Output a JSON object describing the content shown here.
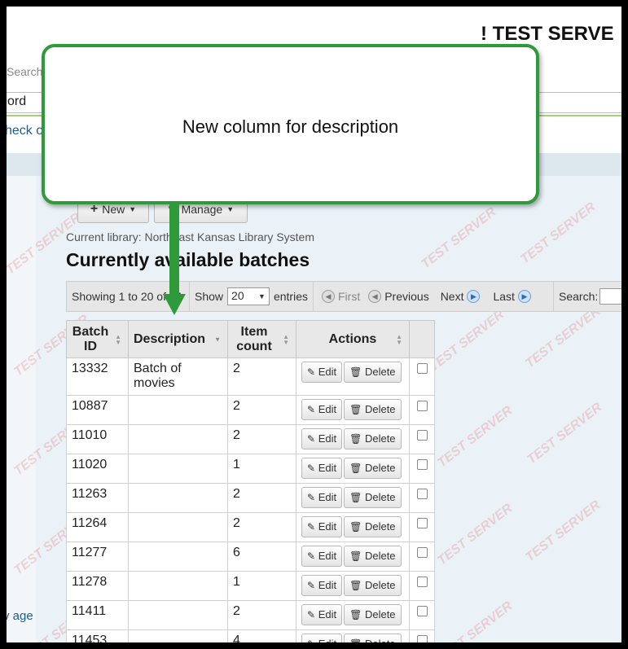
{
  "header": {
    "server_title": "! TEST SERVE",
    "search_label": "Search",
    "keyword_value": "ord",
    "check_link": "heck o",
    "page_link": "v age"
  },
  "watermark_text": "TEST SERVER",
  "toolbar": {
    "new_label": "New",
    "manage_label": "Manage"
  },
  "current_library": "Current library: Northeast Kansas Library System",
  "page_title": "Currently available batches",
  "datatable": {
    "info": "Showing 1 to 20 of 24",
    "show_label": "Show",
    "length_value": "20",
    "entries_label": "entries",
    "first": "First",
    "previous": "Previous",
    "next": "Next",
    "last": "Last",
    "search_label": "Search:"
  },
  "table": {
    "columns": [
      "Batch ID",
      "Description",
      "Item count",
      "Actions"
    ],
    "edit_label": "Edit",
    "delete_label": "Delete",
    "rows": [
      {
        "id": "13332",
        "description": "Batch of movies",
        "count": "2"
      },
      {
        "id": "10887",
        "description": "",
        "count": "2"
      },
      {
        "id": "11010",
        "description": "",
        "count": "2"
      },
      {
        "id": "11020",
        "description": "",
        "count": "1"
      },
      {
        "id": "11263",
        "description": "",
        "count": "2"
      },
      {
        "id": "11264",
        "description": "",
        "count": "2"
      },
      {
        "id": "11277",
        "description": "",
        "count": "6"
      },
      {
        "id": "11278",
        "description": "",
        "count": "1"
      },
      {
        "id": "11411",
        "description": "",
        "count": "2"
      },
      {
        "id": "11453",
        "description": "",
        "count": "4"
      }
    ]
  },
  "callout": {
    "text": "New column for description",
    "color": "#2f9a3a"
  }
}
